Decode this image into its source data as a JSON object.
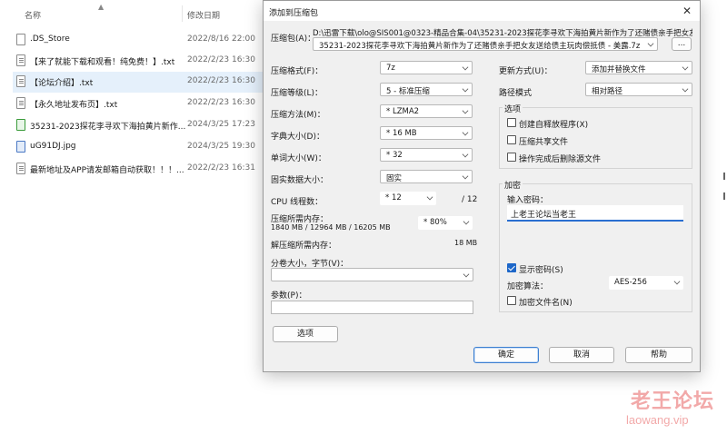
{
  "explorer": {
    "columns": {
      "name": "名称",
      "modified": "修改日期"
    },
    "files": [
      {
        "name": ".DS_Store",
        "date": "2022/8/16 22:00",
        "icon": "file-icon"
      },
      {
        "name": "【来了就能下载和观看！纯免费！】.txt",
        "date": "2022/2/23 16:30",
        "icon": "text-file-icon"
      },
      {
        "name": "【论坛介绍】.txt",
        "date": "2022/2/23 16:30",
        "icon": "text-file-icon",
        "selected": true
      },
      {
        "name": "【永久地址发布页】.txt",
        "date": "2022/2/23 16:30",
        "icon": "text-file-icon"
      },
      {
        "name": "35231-2023探花李寻欢下海拍黄片新作...",
        "date": "2024/3/25 17:23",
        "icon": "executable-icon"
      },
      {
        "name": "uG91DJ.jpg",
        "date": "2024/3/25 19:30",
        "icon": "image-file-icon"
      },
      {
        "name": "最新地址及APP请发邮箱自动获取！！！...",
        "date": "2022/2/23 16:31",
        "icon": "text-file-icon"
      }
    ]
  },
  "dialog": {
    "title": "添加到压缩包",
    "archive": {
      "label": "压缩包(A)：",
      "folder_path": "D:\\迅雷下载\\olo@SIS001@0323-精品合集-04\\35231-2023探花李寻欢下海拍黄片新作为了还赌债亲手把女友送给",
      "filename": "35231-2023探花李寻欢下海拍黄片新作为了还赌债亲手把女友送给债主玩肉偿抵债 - 美露.7z",
      "browse_label": "..."
    },
    "left": {
      "format": {
        "label": "压缩格式(F)：",
        "value": "7z"
      },
      "level": {
        "label": "压缩等级(L)：",
        "value": "5 - 标准压缩"
      },
      "method": {
        "label": "压缩方法(M)：",
        "value": "* LZMA2"
      },
      "dict": {
        "label": "字典大小(D)：",
        "value": "* 16 MB"
      },
      "word": {
        "label": "单词大小(W)：",
        "value": "* 32"
      },
      "solid": {
        "label": "固实数据大小：",
        "value": "固实"
      },
      "cpu": {
        "label": "CPU 线程数：",
        "value": "* 12",
        "max": "/ 12"
      },
      "mem_compress": {
        "label": "压缩所需内存：",
        "detail": "1840 MB / 12964 MB / 16205 MB",
        "value": "* 80%"
      },
      "mem_decompress": {
        "label": "解压缩所需内存：",
        "value": "18 MB"
      },
      "split": {
        "label": "分卷大小，字节(V)：",
        "value": ""
      },
      "params": {
        "label": "参数(P)：",
        "value": ""
      },
      "options_button": "选项"
    },
    "right": {
      "update": {
        "label": "更新方式(U)：",
        "value": "添加并替换文件"
      },
      "pathmode": {
        "label": "路径模式",
        "value": "相对路径"
      },
      "options": {
        "title": "选项",
        "sfx": {
          "label": "创建自释放程序(X)",
          "checked": false
        },
        "shared": {
          "label": "压缩共享文件",
          "checked": false
        },
        "delete_after": {
          "label": "操作完成后删除源文件",
          "checked": false
        }
      },
      "encryption": {
        "title": "加密",
        "password_label": "输入密码：",
        "password_value": "上老王论坛当老王",
        "show_password": {
          "label": "显示密码(S)",
          "checked": true
        },
        "method": {
          "label": "加密算法：",
          "value": "AES-256"
        },
        "encrypt_names": {
          "label": "加密文件名(N)",
          "checked": false
        }
      }
    },
    "buttons": {
      "ok": "确定",
      "cancel": "取消",
      "help": "帮助"
    }
  },
  "watermark": {
    "title": "老王论坛",
    "url": "laowang.vip"
  },
  "colors": {
    "accent": "#1d67c9",
    "selected_row": "#e5f0fb",
    "watermark": "#f2a9a9"
  }
}
